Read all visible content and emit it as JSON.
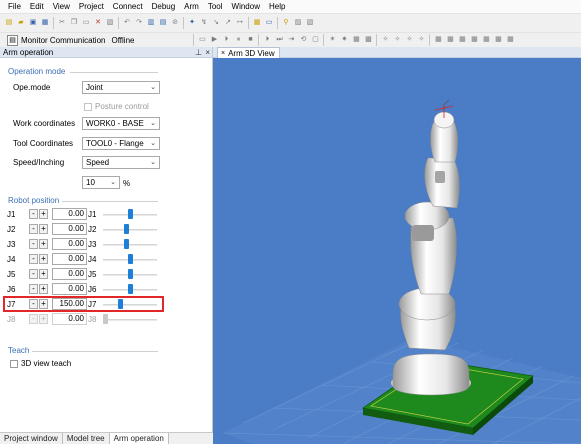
{
  "menu": [
    "File",
    "Edit",
    "View",
    "Project",
    "Connect",
    "Debug",
    "Arm",
    "Tool",
    "Window",
    "Help"
  ],
  "toolbar2": {
    "monitor_label": "Monitor Communication",
    "status": "Offline"
  },
  "panel": {
    "title": "Arm operation",
    "operation_mode": {
      "title": "Operation mode",
      "ope_mode_label": "Ope.mode",
      "ope_mode_value": "Joint",
      "posture_control_label": "Posture control",
      "work_coordinates_label": "Work coordinates",
      "work_coordinates_value": "WORK0 - BASE",
      "tool_coordinates_label": "Tool Coordinates",
      "tool_coordinates_value": "TOOL0 - Flange",
      "speed_label": "Speed/Inching",
      "speed_value": "Speed",
      "percent_value": "10",
      "percent_unit": "%"
    },
    "robot_position": {
      "title": "Robot position",
      "joints": [
        {
          "name": "J1",
          "value": "0.00",
          "slider_fraction": 0.5,
          "enabled": true
        },
        {
          "name": "J2",
          "value": "0.00",
          "slider_fraction": 0.42,
          "enabled": true
        },
        {
          "name": "J3",
          "value": "0.00",
          "slider_fraction": 0.42,
          "enabled": true
        },
        {
          "name": "J4",
          "value": "0.00",
          "slider_fraction": 0.5,
          "enabled": true
        },
        {
          "name": "J5",
          "value": "0.00",
          "slider_fraction": 0.5,
          "enabled": true
        },
        {
          "name": "J6",
          "value": "0.00",
          "slider_fraction": 0.5,
          "enabled": true
        },
        {
          "name": "J7",
          "value": "150.00",
          "slider_fraction": 0.3,
          "enabled": true
        },
        {
          "name": "J8",
          "value": "0.00",
          "slider_fraction": 0.0,
          "enabled": false
        }
      ],
      "minus_label": "-",
      "plus_label": "+"
    },
    "teach": {
      "title": "Teach",
      "view_teach_label": "3D view teach"
    }
  },
  "bottom_tabs": [
    "Project window",
    "Model tree",
    "Arm operation"
  ],
  "view": {
    "tab_label": "Arm 3D View"
  },
  "colors": {
    "viewport_bg": "#4a7dc6",
    "accent": "#1e7fd8",
    "highlight": "#e3262a",
    "robot_base": "#1e8a1e"
  }
}
